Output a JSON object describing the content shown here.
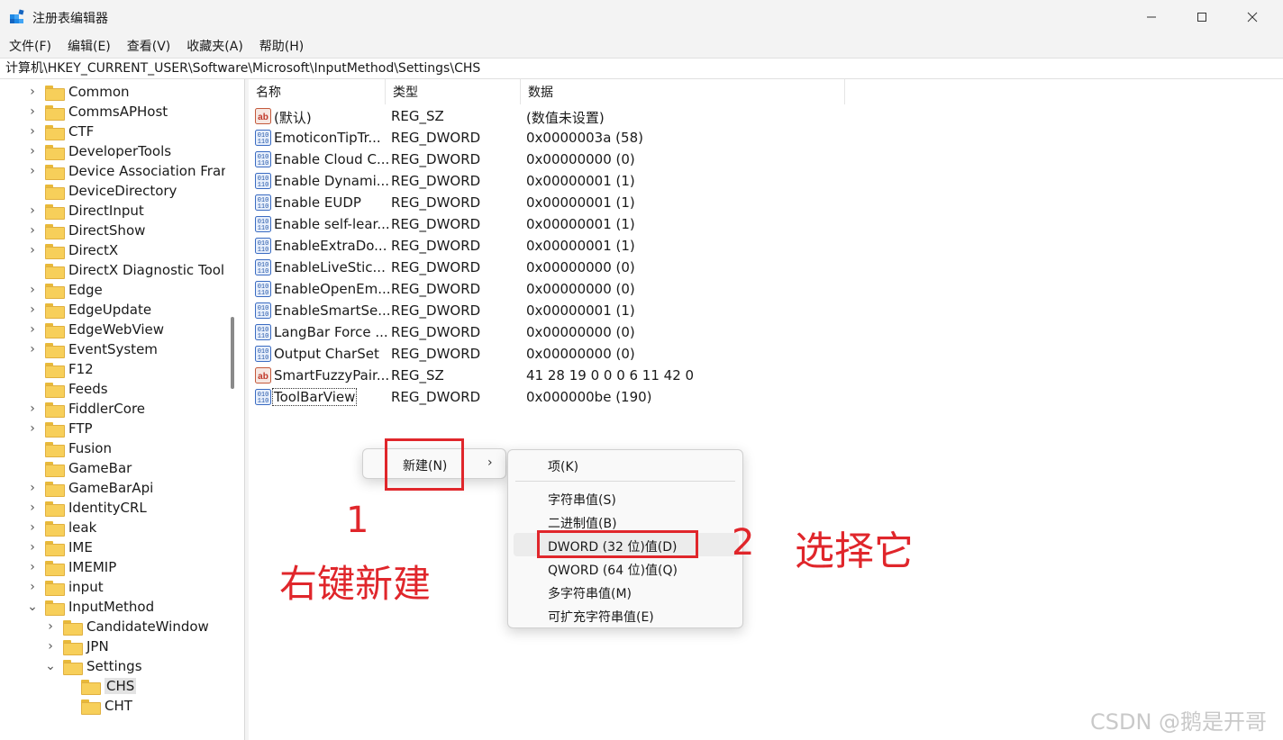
{
  "window": {
    "title": "注册表编辑器",
    "minimize_icon": "minimize-icon",
    "maximize_icon": "maximize-icon",
    "close_icon": "close-icon"
  },
  "menu": [
    "文件(F)",
    "编辑(E)",
    "查看(V)",
    "收藏夹(A)",
    "帮助(H)"
  ],
  "address": "计算机\\HKEY_CURRENT_USER\\Software\\Microsoft\\InputMethod\\Settings\\CHS",
  "tree": [
    {
      "label": "Common",
      "expandable": true
    },
    {
      "label": "CommsAPHost",
      "expandable": true
    },
    {
      "label": "CTF",
      "expandable": true
    },
    {
      "label": "DeveloperTools",
      "expandable": true
    },
    {
      "label": "Device Association Framework",
      "expandable": true
    },
    {
      "label": "DeviceDirectory",
      "expandable": false
    },
    {
      "label": "DirectInput",
      "expandable": true
    },
    {
      "label": "DirectShow",
      "expandable": true
    },
    {
      "label": "DirectX",
      "expandable": true
    },
    {
      "label": "DirectX Diagnostic Tool",
      "expandable": false
    },
    {
      "label": "Edge",
      "expandable": true
    },
    {
      "label": "EdgeUpdate",
      "expandable": true
    },
    {
      "label": "EdgeWebView",
      "expandable": true
    },
    {
      "label": "EventSystem",
      "expandable": true
    },
    {
      "label": "F12",
      "expandable": false
    },
    {
      "label": "Feeds",
      "expandable": false
    },
    {
      "label": "FiddlerCore",
      "expandable": true
    },
    {
      "label": "FTP",
      "expandable": true
    },
    {
      "label": "Fusion",
      "expandable": false
    },
    {
      "label": "GameBar",
      "expandable": false
    },
    {
      "label": "GameBarApi",
      "expandable": true
    },
    {
      "label": "IdentityCRL",
      "expandable": true
    },
    {
      "label": "leak",
      "expandable": true
    },
    {
      "label": "IME",
      "expandable": true
    },
    {
      "label": "IMEMIP",
      "expandable": true
    },
    {
      "label": "input",
      "expandable": true
    },
    {
      "label": "InputMethod",
      "expandable": true,
      "expanded": true
    },
    {
      "label": "CandidateWindow",
      "expandable": true,
      "level": 1
    },
    {
      "label": "JPN",
      "expandable": true,
      "level": 1
    },
    {
      "label": "Settings",
      "expandable": true,
      "expanded": true,
      "level": 1
    },
    {
      "label": "CHS",
      "expandable": false,
      "level": 2,
      "selected": true
    },
    {
      "label": "CHT",
      "expandable": false,
      "level": 2
    }
  ],
  "columns": {
    "name": "名称",
    "type": "类型",
    "data": "数据"
  },
  "values": [
    {
      "icon": "string-value-icon",
      "name": "(默认)",
      "type": "REG_SZ",
      "data": "(数值未设置)"
    },
    {
      "icon": "binary-value-icon",
      "name": "EmoticonTipTr...",
      "type": "REG_DWORD",
      "data": "0x0000003a (58)"
    },
    {
      "icon": "binary-value-icon",
      "name": "Enable Cloud C...",
      "type": "REG_DWORD",
      "data": "0x00000000 (0)"
    },
    {
      "icon": "binary-value-icon",
      "name": "Enable Dynami...",
      "type": "REG_DWORD",
      "data": "0x00000001 (1)"
    },
    {
      "icon": "binary-value-icon",
      "name": "Enable EUDP",
      "type": "REG_DWORD",
      "data": "0x00000001 (1)"
    },
    {
      "icon": "binary-value-icon",
      "name": "Enable self-lear...",
      "type": "REG_DWORD",
      "data": "0x00000001 (1)"
    },
    {
      "icon": "binary-value-icon",
      "name": "EnableExtraDo...",
      "type": "REG_DWORD",
      "data": "0x00000001 (1)"
    },
    {
      "icon": "binary-value-icon",
      "name": "EnableLiveStic...",
      "type": "REG_DWORD",
      "data": "0x00000000 (0)"
    },
    {
      "icon": "binary-value-icon",
      "name": "EnableOpenEm...",
      "type": "REG_DWORD",
      "data": "0x00000000 (0)"
    },
    {
      "icon": "binary-value-icon",
      "name": "EnableSmartSe...",
      "type": "REG_DWORD",
      "data": "0x00000001 (1)"
    },
    {
      "icon": "binary-value-icon",
      "name": "LangBar Force ...",
      "type": "REG_DWORD",
      "data": "0x00000000 (0)"
    },
    {
      "icon": "binary-value-icon",
      "name": "Output CharSet",
      "type": "REG_DWORD",
      "data": "0x00000000 (0)"
    },
    {
      "icon": "string-value-icon",
      "name": "SmartFuzzyPair...",
      "type": "REG_SZ",
      "data": "41 28 19 0 0 0 6 11 42 0"
    },
    {
      "icon": "binary-value-icon",
      "name": "ToolBarView",
      "type": "REG_DWORD",
      "data": "0x000000be (190)",
      "focused": true
    }
  ],
  "context_menu": {
    "new_label": "新建(N)",
    "submenu": [
      "项(K)",
      "字符串值(S)",
      "二进制值(B)",
      "DWORD (32 位)值(D)",
      "QWORD (64 位)值(Q)",
      "多字符串值(M)",
      "可扩充字符串值(E)"
    ]
  },
  "annotations": {
    "step1_number": "1",
    "step1_text": "右键新建",
    "step2_number": "2",
    "step2_text": "选择它",
    "color": "#e0262b"
  },
  "watermark": "CSDN @鹅是开哥"
}
